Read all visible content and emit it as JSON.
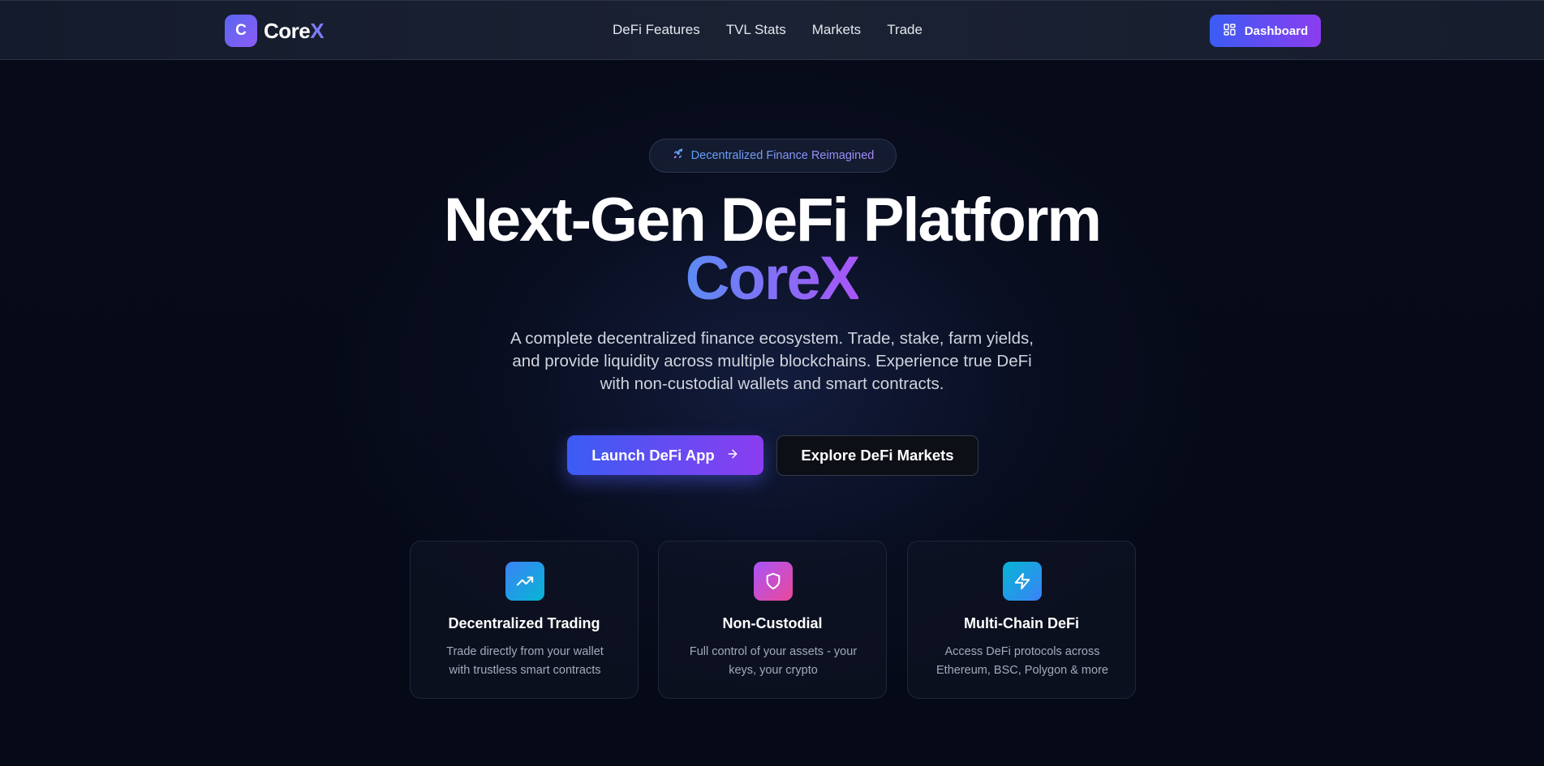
{
  "colors": {
    "accent_blue": "#3b5cf4",
    "accent_purple": "#8b3df0",
    "background": "#060a17",
    "nav_background": "#1b2233"
  },
  "nav": {
    "logo_letter": "C",
    "logo_text_main": "Core",
    "logo_text_accent": "X",
    "links": [
      "DeFi Features",
      "TVL Stats",
      "Markets",
      "Trade"
    ],
    "dashboard_button": {
      "label": "Dashboard",
      "icon": "grid-icon"
    }
  },
  "hero": {
    "pill": {
      "icon": "rocket-icon",
      "text": "Decentralized Finance Reimagined"
    },
    "title_line1": "Next-Gen DeFi Platform",
    "title_line2": "CoreX",
    "subtitle": "A complete decentralized finance ecosystem. Trade, stake, farm yields, and provide liquidity across multiple blockchains. Experience true DeFi with non-custodial wallets and smart contracts.",
    "primary_button": {
      "label": "Launch DeFi App",
      "icon": "arrow-right-icon"
    },
    "secondary_button": {
      "label": "Explore DeFi Markets"
    }
  },
  "features": [
    {
      "icon": "trending-up-icon",
      "title": "Decentralized Trading",
      "description": "Trade directly from your wallet with trustless smart contracts"
    },
    {
      "icon": "shield-icon",
      "title": "Non-Custodial",
      "description": "Full control of your assets - your keys, your crypto"
    },
    {
      "icon": "zap-icon",
      "title": "Multi-Chain DeFi",
      "description": "Access DeFi protocols across Ethereum, BSC, Polygon & more"
    }
  ]
}
